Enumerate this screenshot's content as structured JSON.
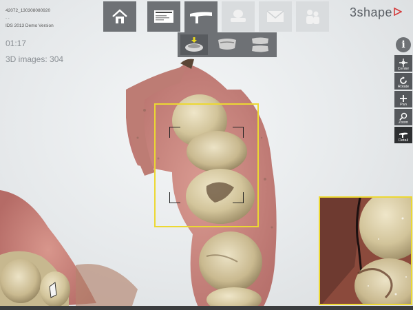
{
  "case": {
    "id": "42072_130308080920",
    "sub": "- -",
    "version": "IDS 2013 Demo Version"
  },
  "scan": {
    "timer": "01:17",
    "images_label": "3D images: 304"
  },
  "brand": {
    "logo_text": "3shape"
  },
  "toolbar": {
    "steps": [
      {
        "name": "home-button",
        "icon": "home-icon",
        "state": "normal"
      },
      {
        "name": "order-form-button",
        "icon": "order-form-icon",
        "state": "normal"
      },
      {
        "name": "scan-button",
        "icon": "scanner-wand-icon",
        "state": "active"
      },
      {
        "name": "post-processing-button",
        "icon": "post-processing-icon",
        "state": "disabled"
      },
      {
        "name": "send-button",
        "icon": "envelope-icon",
        "state": "disabled"
      },
      {
        "name": "patient-button",
        "icon": "people-icon",
        "state": "disabled"
      }
    ],
    "substeps": [
      {
        "name": "preparation-scan-button",
        "icon": "preparation-jaw-icon",
        "current": true
      },
      {
        "name": "opposing-jaw-button",
        "icon": "opposing-jaw-icon",
        "current": false
      },
      {
        "name": "bite-scan-button",
        "icon": "bite-icon",
        "current": false
      }
    ]
  },
  "tools": {
    "info_glyph": "i",
    "items": [
      {
        "label": "Center",
        "icon": "center-icon"
      },
      {
        "label": "Rotate",
        "icon": "rotate-icon"
      },
      {
        "label": "Pan",
        "icon": "pan-icon"
      },
      {
        "label": "Zoom",
        "icon": "zoom-icon"
      },
      {
        "label": "Detail",
        "icon": "detail-icon"
      }
    ]
  },
  "colors": {
    "toolbar_bg": "#6e7175",
    "frame": "#ecd832",
    "gum": "#c8877f",
    "tooth": "#d9cfae"
  }
}
